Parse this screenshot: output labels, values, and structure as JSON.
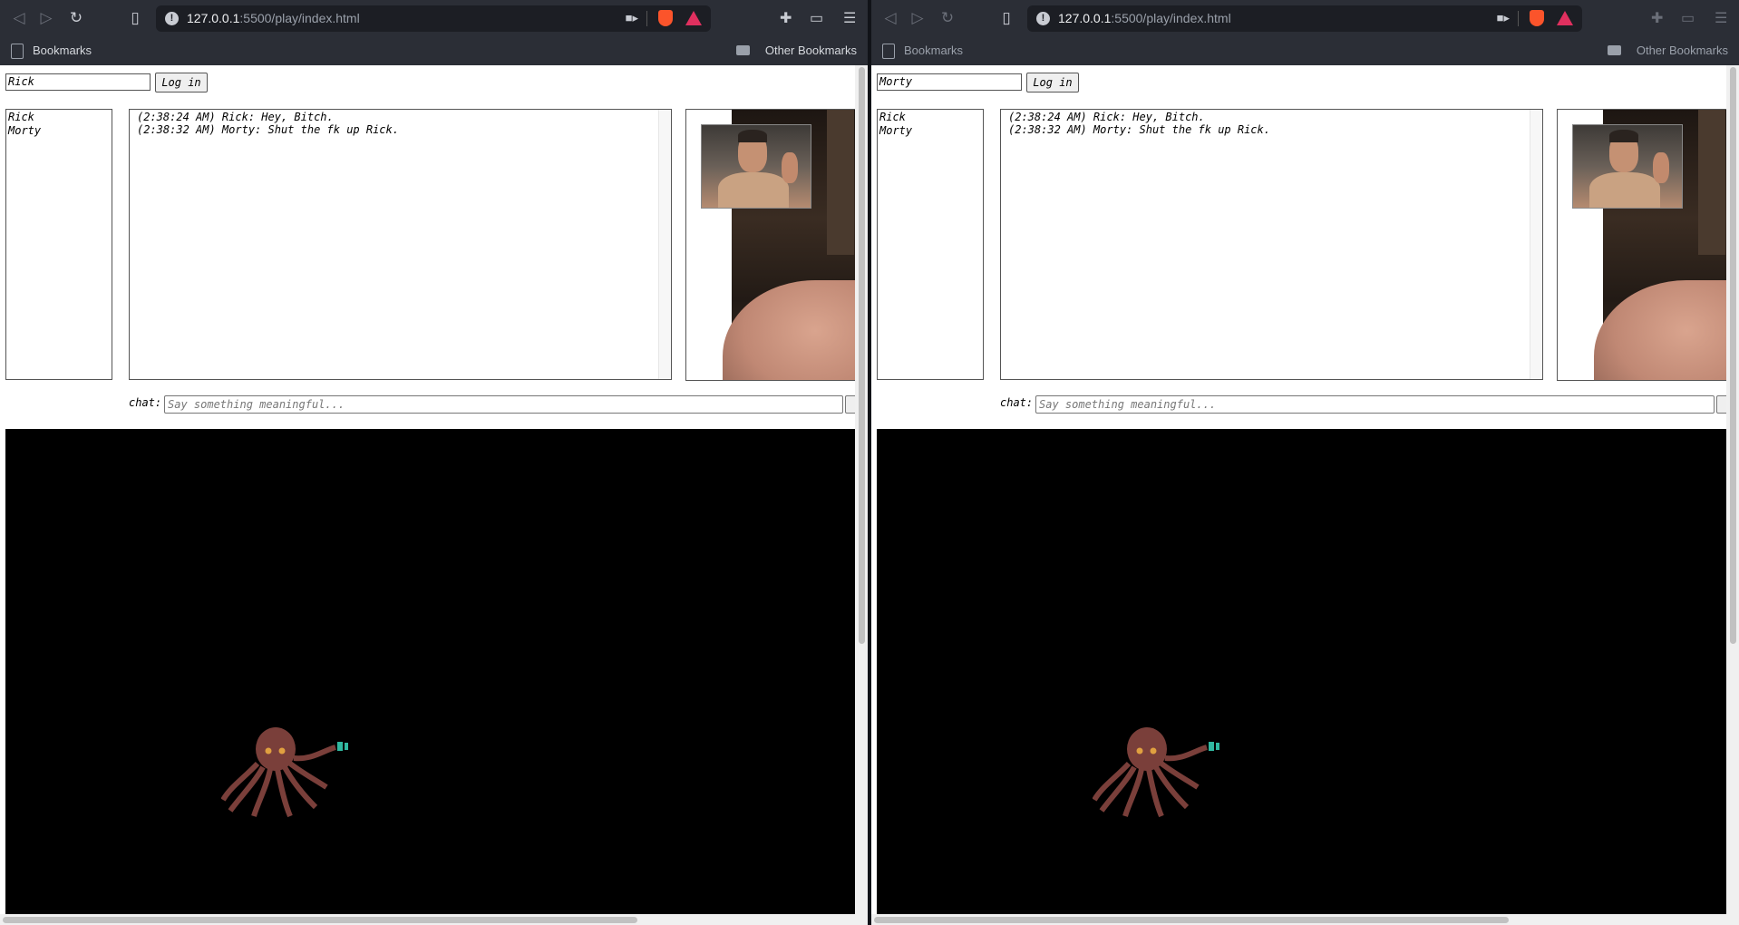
{
  "windows": [
    {
      "id": "rick",
      "url_host": "127.0.0.1",
      "url_rest": ":5500/play/index.html",
      "bookmarks_label": "Bookmarks",
      "other_bookmarks_label": "Other Bookmarks",
      "name_value": "Rick",
      "login_label": "Log in",
      "users": [
        "Rick",
        "Morty"
      ],
      "messages": [
        "(2:38:24 AM) Rick: Hey, Bitch.",
        "(2:38:32 AM) Morty: Shut the fk up Rick."
      ],
      "chat_label": "chat:",
      "chat_placeholder": "Say something meaningful..."
    },
    {
      "id": "morty",
      "url_host": "127.0.0.1",
      "url_rest": ":5500/play/index.html",
      "bookmarks_label": "Bookmarks",
      "other_bookmarks_label": "Other Bookmarks",
      "name_value": "Morty",
      "login_label": "Log in",
      "users": [
        "Rick",
        "Morty"
      ],
      "messages": [
        "(2:38:24 AM) Rick: Hey, Bitch.",
        "(2:38:32 AM) Morty: Shut the fk up Rick."
      ],
      "chat_label": "chat:",
      "chat_placeholder": "Say something meaningful..."
    }
  ],
  "icons": {
    "back": "back-icon",
    "forward": "forward-icon",
    "reload": "reload-icon",
    "bookmark": "bookmark-icon",
    "camera": "camera-icon",
    "brave": "brave-shield-icon",
    "rewards": "brave-rewards-icon",
    "extensions": "extensions-icon",
    "wallet": "wallet-icon",
    "menu": "menu-icon"
  }
}
